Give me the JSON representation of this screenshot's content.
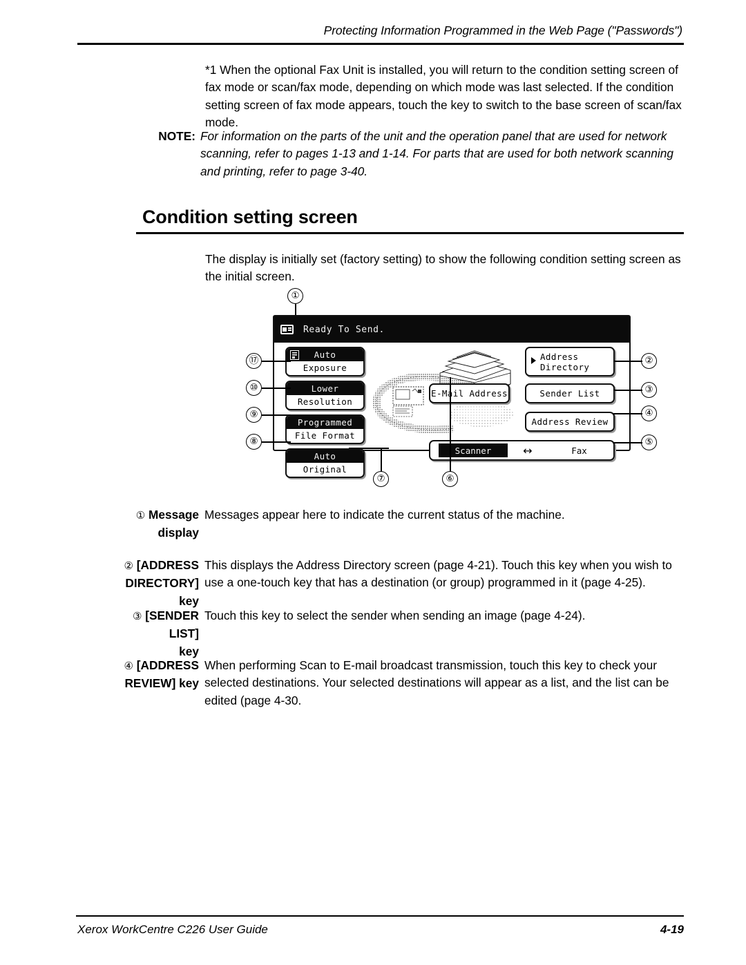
{
  "header": {
    "running_title": "Protecting Information Programmed in the Web Page (\"Passwords\")"
  },
  "intro": {
    "footnote": "*1 When the optional Fax Unit is installed, you will return to the condition setting screen of fax mode or scan/fax mode, depending on which mode was last selected. If the condition setting screen of fax mode appears, touch the  key to switch to the base screen of scan/fax mode."
  },
  "note": {
    "label": "NOTE:",
    "text": "For information on the parts of the unit and the operation panel that are used for network scanning, refer to pages 1-13 and 1-14. For parts that are used for both network scanning and printing, refer to page 3-40."
  },
  "section": {
    "title": "Condition setting screen",
    "lead": "The display is initially set (factory setting) to show the following condition setting screen as the initial screen."
  },
  "figure": {
    "status_bar": {
      "icon": "message-card-icon",
      "text": "Ready To Send."
    },
    "left_keys": [
      {
        "callout": "⑰",
        "top": "Auto",
        "bottom": "Exposure",
        "icon": "exposure-icon"
      },
      {
        "callout": "⑩",
        "top": "Lower",
        "bottom": "Resolution",
        "icon": ""
      },
      {
        "callout": "⑨",
        "top": "Programmed",
        "bottom": "File Format",
        "icon": ""
      },
      {
        "callout": "⑧",
        "top": "Auto",
        "bottom": "Original",
        "icon": ""
      }
    ],
    "address_directory": {
      "callout": "②",
      "line1": "Address",
      "line2": "Directory",
      "icon": "play-triangle-icon"
    },
    "email_address": {
      "callout": "⑥",
      "label": "E-Mail Address"
    },
    "sender_list": {
      "callout": "③",
      "label": "Sender List"
    },
    "address_review": {
      "callout": "④",
      "label": "Address Review"
    },
    "mode_switch": {
      "callout": "⑤",
      "selected": "Scanner",
      "arrow": "↔",
      "other": "Fax"
    },
    "callout_top": "①",
    "callout_seven": "⑦",
    "illustration": "network-scanner-mfp-illustration"
  },
  "descriptions": [
    {
      "num": "①",
      "label_line1": "Message",
      "label_line2": "display",
      "body": "Messages appear here to indicate the current status of the machine."
    },
    {
      "num": "②",
      "label_line1": "[ADDRESS",
      "label_line2": "DIRECTORY] key",
      "body": "This displays the Address Directory screen (page 4-21). Touch this key when you wish to use a one-touch key that has a destination (or group) programmed in it (page 4-25)."
    },
    {
      "num": "③",
      "label_line1": "[SENDER LIST]",
      "label_line2": "key",
      "body": "Touch this key to select the sender when sending an image (page 4-24)."
    },
    {
      "num": "④",
      "label_line1": "[ADDRESS",
      "label_line2": "REVIEW] key",
      "body": "When performing Scan to E-mail broadcast transmission, touch this key to check your selected destinations. Your selected destinations will appear as a list, and the list can be edited (page 4-30."
    }
  ],
  "footer": {
    "guide": "Xerox WorkCentre C226 User Guide",
    "page": "4-19"
  }
}
